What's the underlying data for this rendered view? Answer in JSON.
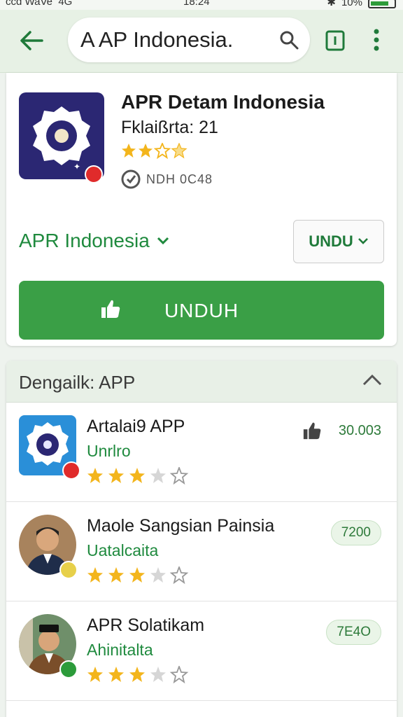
{
  "status_bar": {
    "carrier": "ccd WaVe",
    "network": "4G",
    "time": "18:24",
    "battery": "10%"
  },
  "app_bar": {
    "search_query": "A AP Indonesia."
  },
  "app_card": {
    "title": "APR Detam Indonesia",
    "subtitle": "Fklaißrta: 21",
    "rating": 3,
    "id_text": "NDH 0C48",
    "developer": "APR Indonesia",
    "small_button": "UNDU",
    "install_button": "UNDUH"
  },
  "related": {
    "header": "Dengailk: APP",
    "items": [
      {
        "name": "Artalai9 APP",
        "developer": "Unrlro",
        "rating": 3,
        "meta": "30.003",
        "has_thumb_icon": true
      },
      {
        "name": "Maole Sangsian Painsia",
        "developer": "Uatalcaita",
        "rating": 3,
        "meta": "7200"
      },
      {
        "name": "APR Solatikam",
        "developer": "Ahinitalta",
        "rating": 3,
        "meta": "7E4O"
      }
    ]
  },
  "colors": {
    "accent": "#3a9f46",
    "link": "#1f8a3e",
    "app_icon_bg": "#2b2773"
  }
}
